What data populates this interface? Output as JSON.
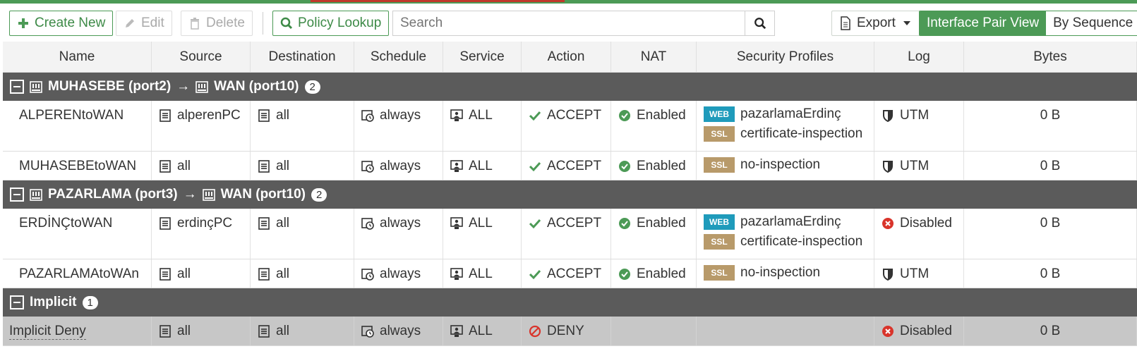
{
  "toolbar": {
    "create_new": "Create New",
    "edit": "Edit",
    "delete": "Delete",
    "policy_lookup": "Policy Lookup",
    "search_placeholder": "Search",
    "export": "Export",
    "view_interface_pair": "Interface Pair View",
    "view_by_sequence": "By Sequence"
  },
  "columns": [
    "Name",
    "Source",
    "Destination",
    "Schedule",
    "Service",
    "Action",
    "NAT",
    "Security Profiles",
    "Log",
    "Bytes"
  ],
  "groups": [
    {
      "src_if": "MUHASEBE (port2)",
      "arrow": "→",
      "dst_if": "WAN (port10)",
      "count": "2",
      "rows": [
        {
          "name": "ALPERENtoWAN",
          "source": "alperenPC",
          "destination": "all",
          "schedule": "always",
          "service": "ALL",
          "action": "ACCEPT",
          "nat": "Enabled",
          "profiles": [
            {
              "type": "WEB",
              "name": "pazarlamaErdinç"
            },
            {
              "type": "SSL",
              "name": "certificate-inspection"
            }
          ],
          "log": "UTM",
          "log_state": "utm",
          "bytes": "0 B"
        },
        {
          "name": "MUHASEBEtoWAN",
          "source": "all",
          "destination": "all",
          "schedule": "always",
          "service": "ALL",
          "action": "ACCEPT",
          "nat": "Enabled",
          "profiles": [
            {
              "type": "SSL",
              "name": "no-inspection"
            }
          ],
          "log": "UTM",
          "log_state": "utm",
          "bytes": "0 B"
        }
      ]
    },
    {
      "src_if": "PAZARLAMA (port3)",
      "arrow": "→",
      "dst_if": "WAN (port10)",
      "count": "2",
      "rows": [
        {
          "name": "ERDİNÇtoWAN",
          "source": "erdinçPC",
          "destination": "all",
          "schedule": "always",
          "service": "ALL",
          "action": "ACCEPT",
          "nat": "Enabled",
          "profiles": [
            {
              "type": "WEB",
              "name": "pazarlamaErdinç"
            },
            {
              "type": "SSL",
              "name": "certificate-inspection"
            }
          ],
          "log": "Disabled",
          "log_state": "disabled",
          "bytes": "0 B"
        },
        {
          "name": "PAZARLAMAtoWAn",
          "source": "all",
          "destination": "all",
          "schedule": "always",
          "service": "ALL",
          "action": "ACCEPT",
          "nat": "Enabled",
          "profiles": [
            {
              "type": "SSL",
              "name": "no-inspection"
            }
          ],
          "log": "UTM",
          "log_state": "utm",
          "bytes": "0 B"
        }
      ]
    }
  ],
  "implicit": {
    "label": "Implicit",
    "count": "1",
    "row": {
      "name": "Implicit Deny",
      "source": "all",
      "destination": "all",
      "schedule": "always",
      "service": "ALL",
      "action": "DENY",
      "log": "Disabled",
      "bytes": "0 B"
    }
  },
  "colors": {
    "green": "#4c9a56",
    "web_badge": "#1f9bbb",
    "ssl_badge": "#b89a6a",
    "deny_red": "#d9342b",
    "group_bg": "#5b5b5b"
  }
}
